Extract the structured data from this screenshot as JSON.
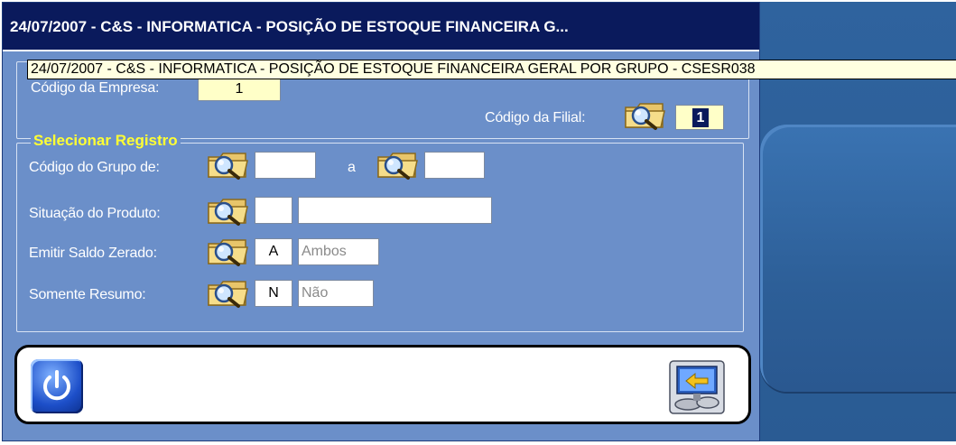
{
  "window": {
    "title": "24/07/2007  -  C&S - INFORMATICA  -  POSIÇÃO DE ESTOQUE FINANCEIRA G...",
    "tooltip": "24/07/2007  -  C&S - INFORMATICA  -  POSIÇÃO DE ESTOQUE FINANCEIRA GERAL POR GRUPO  -  CSESR038"
  },
  "empresa": {
    "codigo_label": "Código da Empresa:",
    "codigo_value": "1",
    "filial_label": "Código da Filial:",
    "filial_value": "1"
  },
  "registro": {
    "legend": "Selecionar Registro",
    "grupo_label": "Código do Grupo de:",
    "grupo_de_value": "",
    "grupo_sep": "a",
    "grupo_ate_value": "",
    "situacao_label": "Situação do Produto:",
    "situacao_code": "",
    "situacao_desc": "",
    "saldo_label": "Emitir Saldo Zerado:",
    "saldo_code": "A",
    "saldo_desc": "Ambos",
    "resumo_label": "Somente Resumo:",
    "resumo_code": "N",
    "resumo_desc": "Não"
  },
  "icons": {
    "lookup": "folder-search-icon",
    "exit": "power-icon",
    "print": "monitor-print-icon"
  },
  "colors": {
    "title_bg": "#0a1a5c",
    "form_bg": "#6b8fc9",
    "legend": "#ffff33",
    "field_required": "#ffffc8",
    "tooltip_bg": "#ffffe1"
  }
}
